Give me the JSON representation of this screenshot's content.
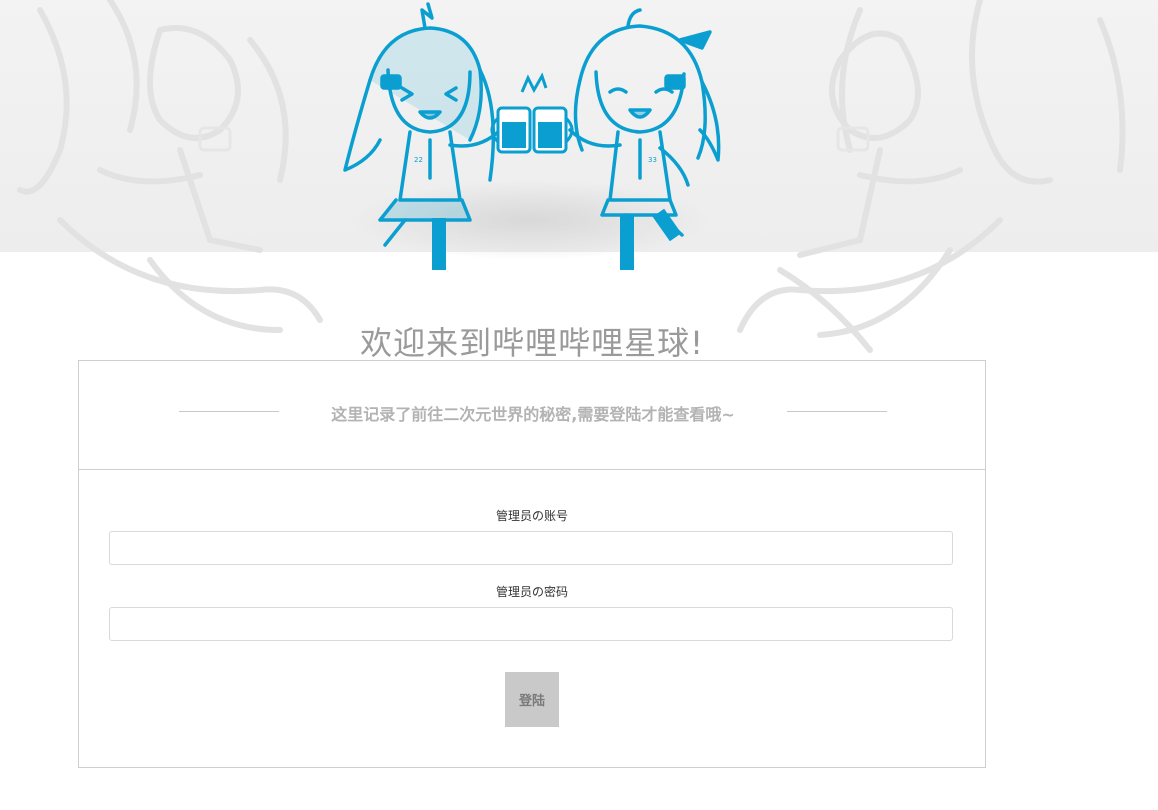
{
  "hero": {
    "welcome_title": "欢迎来到哔哩哔哩星球!",
    "mascot_left_badge": "22",
    "mascot_right_badge": "33"
  },
  "card": {
    "subtitle": "这里记录了前往二次元世界的秘密,需要登陆才能查看哦~",
    "account_label": "管理员の账号",
    "account_value": "",
    "password_label": "管理员の密码",
    "password_value": "",
    "login_label": "登陆"
  },
  "colors": {
    "mascot_blue": "#0a9fd0",
    "button_grey": "#c9c9c9",
    "title_grey": "#9a9a9a"
  }
}
